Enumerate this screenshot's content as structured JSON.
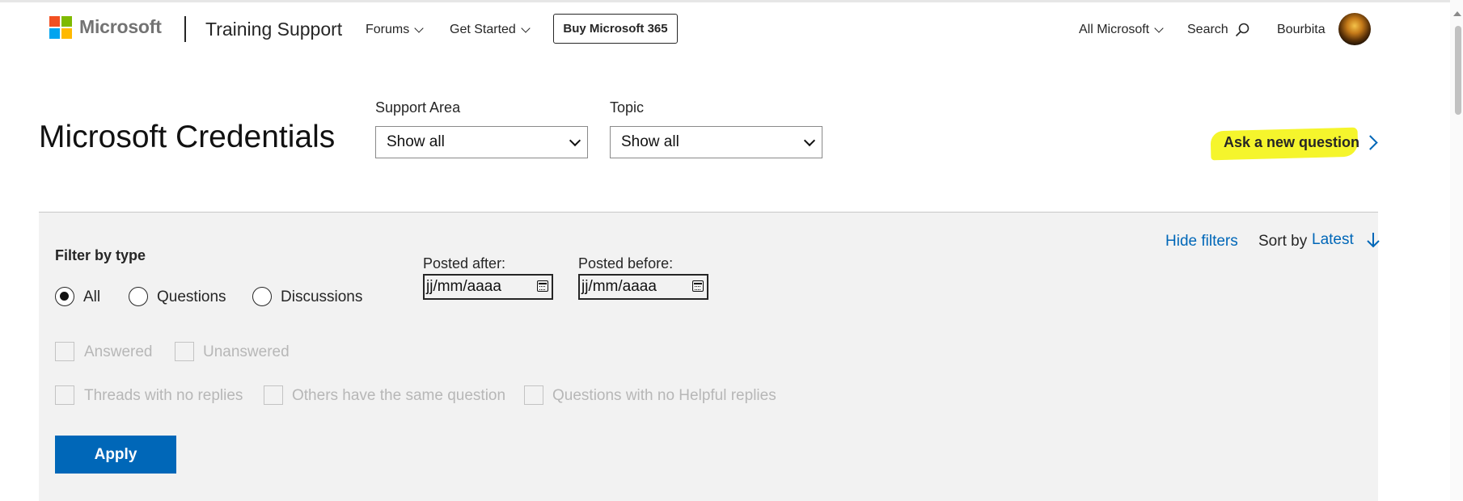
{
  "header": {
    "brand": "Microsoft",
    "site_title": "Training Support",
    "nav": [
      {
        "label": "Forums"
      },
      {
        "label": "Get Started"
      }
    ],
    "buy_label": "Buy Microsoft 365",
    "all_microsoft": "All Microsoft",
    "search_label": "Search",
    "user_name": "Bourbita",
    "logo_colors": [
      "#f25022",
      "#7fba00",
      "#00a4ef",
      "#ffb900"
    ]
  },
  "title_row": {
    "page_title": "Microsoft Credentials",
    "support_area": {
      "label": "Support Area",
      "value": "Show all"
    },
    "topic": {
      "label": "Topic",
      "value": "Show all"
    },
    "ask_link": "Ask a new question",
    "highlight_color": "#f5f52c"
  },
  "filters": {
    "hide_filters": "Hide filters",
    "sort_label": "Sort by",
    "sort_value": "Latest",
    "filter_type_label": "Filter by type",
    "types": [
      {
        "label": "All",
        "selected": true
      },
      {
        "label": "Questions",
        "selected": false
      },
      {
        "label": "Discussions",
        "selected": false
      }
    ],
    "posted_after": {
      "label": "Posted after:",
      "value": "jj/mm/aaaa"
    },
    "posted_before": {
      "label": "Posted before:",
      "value": "jj/mm/aaaa"
    },
    "checkboxes": [
      {
        "label": "Answered"
      },
      {
        "label": "Unanswered"
      },
      {
        "label": "Threads with no replies"
      },
      {
        "label": "Others have the same question"
      },
      {
        "label": "Questions with no Helpful replies"
      }
    ],
    "apply_label": "Apply",
    "accent_color": "#0067b8"
  }
}
